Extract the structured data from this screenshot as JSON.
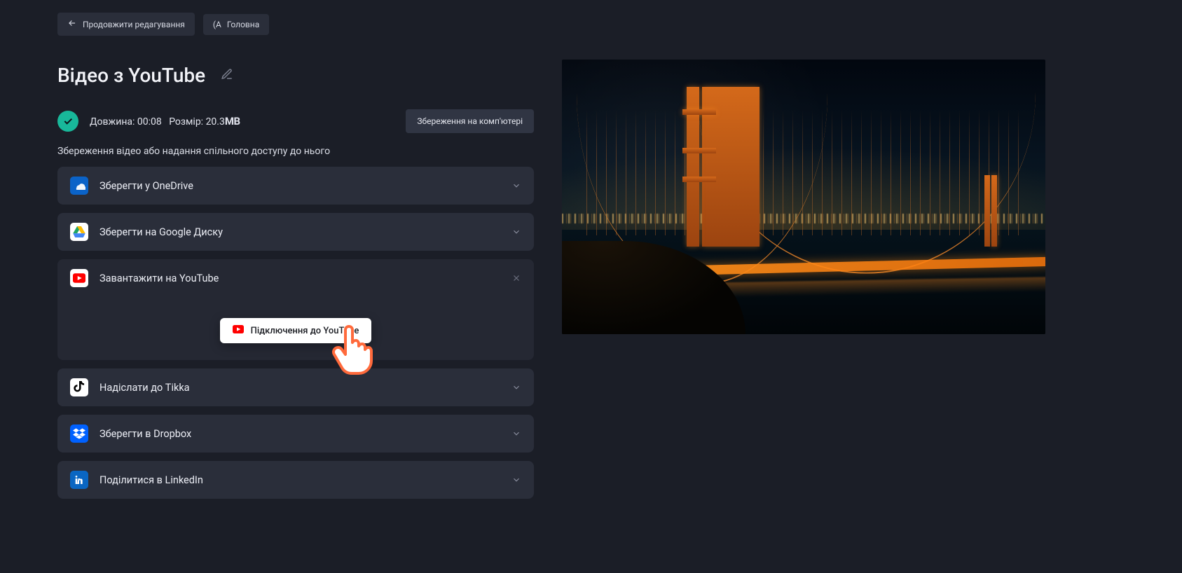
{
  "nav": {
    "continue_editing": "Продовжити редагування",
    "home_prefix": "(А",
    "home": "Головна"
  },
  "title": "Відео з YouTube",
  "meta": {
    "length_label": "Довжина:",
    "length_value": "00:08",
    "size_label": "Розмір:",
    "size_value": "20.3",
    "size_unit": "МВ"
  },
  "save_computer": "Збереження на комп'ютері",
  "subtitle": "Збереження відео або надання спільного доступу до нього",
  "services": {
    "onedrive": "Зберегти у OneDrive",
    "gdrive": "Зберегти на Google Диску",
    "youtube": "Завантажити на YouTube",
    "tiktok": "Надіслати до Tikka",
    "dropbox": "Зберегти в Dropbox",
    "linkedin": "Поділитися в LinkedIn"
  },
  "connect_youtube": "Підключення до YouTube"
}
